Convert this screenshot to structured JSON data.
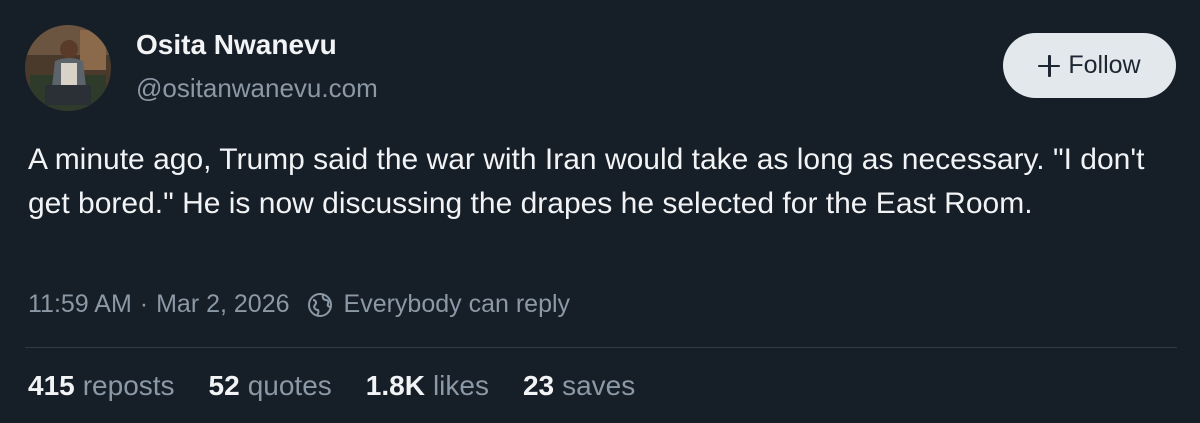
{
  "author": {
    "display_name": "Osita Nwanevu",
    "handle": "@ositanwanevu.com"
  },
  "follow_button": {
    "label": "Follow",
    "icon": "plus-icon"
  },
  "post": {
    "text": "A minute ago, Trump said the war with Iran would take as long as necessary. \"I don't get bored.\" He is now discussing the drapes he selected for the East Room."
  },
  "meta": {
    "time": "11:59 AM",
    "separator": "·",
    "date": "Mar 2, 2026",
    "reply_icon": "globe-icon",
    "reply_setting": "Everybody can reply"
  },
  "stats": {
    "reposts": {
      "count": "415",
      "label": "reposts"
    },
    "quotes": {
      "count": "52",
      "label": "quotes"
    },
    "likes": {
      "count": "1.8K",
      "label": "likes"
    },
    "saves": {
      "count": "23",
      "label": "saves"
    }
  },
  "colors": {
    "background": "#161e27",
    "text": "#f1f3f5",
    "muted": "#8b98a5",
    "button_bg": "#e3e8ed"
  }
}
